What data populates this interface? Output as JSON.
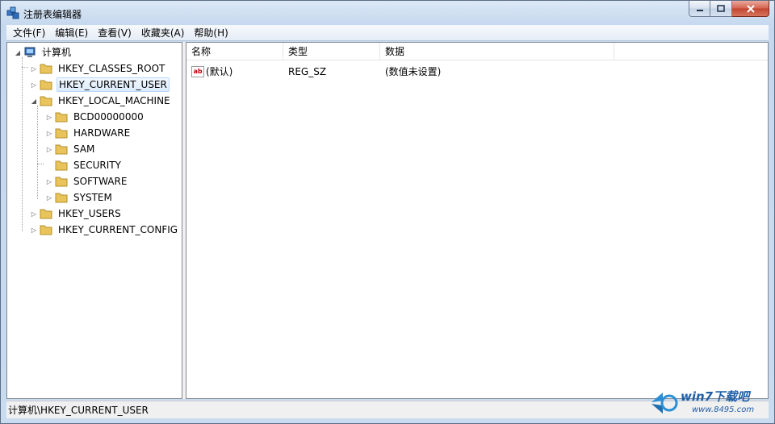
{
  "window": {
    "title": "注册表编辑器"
  },
  "menu": [
    {
      "label": "文件(F)"
    },
    {
      "label": "编辑(E)"
    },
    {
      "label": "查看(V)"
    },
    {
      "label": "收藏夹(A)"
    },
    {
      "label": "帮助(H)"
    }
  ],
  "tree": {
    "root": "计算机",
    "nodes": [
      {
        "label": "HKEY_CLASSES_ROOT",
        "expander": "collapsed"
      },
      {
        "label": "HKEY_CURRENT_USER",
        "expander": "collapsed",
        "selected": true
      },
      {
        "label": "HKEY_LOCAL_MACHINE",
        "expander": "expanded"
      },
      {
        "label": "BCD00000000",
        "expander": "collapsed"
      },
      {
        "label": "HARDWARE",
        "expander": "collapsed"
      },
      {
        "label": "SAM",
        "expander": "collapsed"
      },
      {
        "label": "SECURITY",
        "expander": "none"
      },
      {
        "label": "SOFTWARE",
        "expander": "collapsed"
      },
      {
        "label": "SYSTEM",
        "expander": "collapsed"
      },
      {
        "label": "HKEY_USERS",
        "expander": "collapsed"
      },
      {
        "label": "HKEY_CURRENT_CONFIG",
        "expander": "collapsed"
      }
    ]
  },
  "list": {
    "columns": [
      "名称",
      "类型",
      "数据"
    ],
    "rows": [
      {
        "name": "(默认)",
        "type": "REG_SZ",
        "data": "(数值未设置)",
        "icon": "string-value-icon"
      }
    ]
  },
  "status": {
    "path": "计算机\\HKEY_CURRENT_USER"
  },
  "watermark": {
    "brand": "win7下载吧",
    "url": "www.8495.com"
  },
  "colors": {
    "folder": "#e8c45a",
    "selection": "#dcebfc",
    "title_bg": "#c5d8ee"
  }
}
